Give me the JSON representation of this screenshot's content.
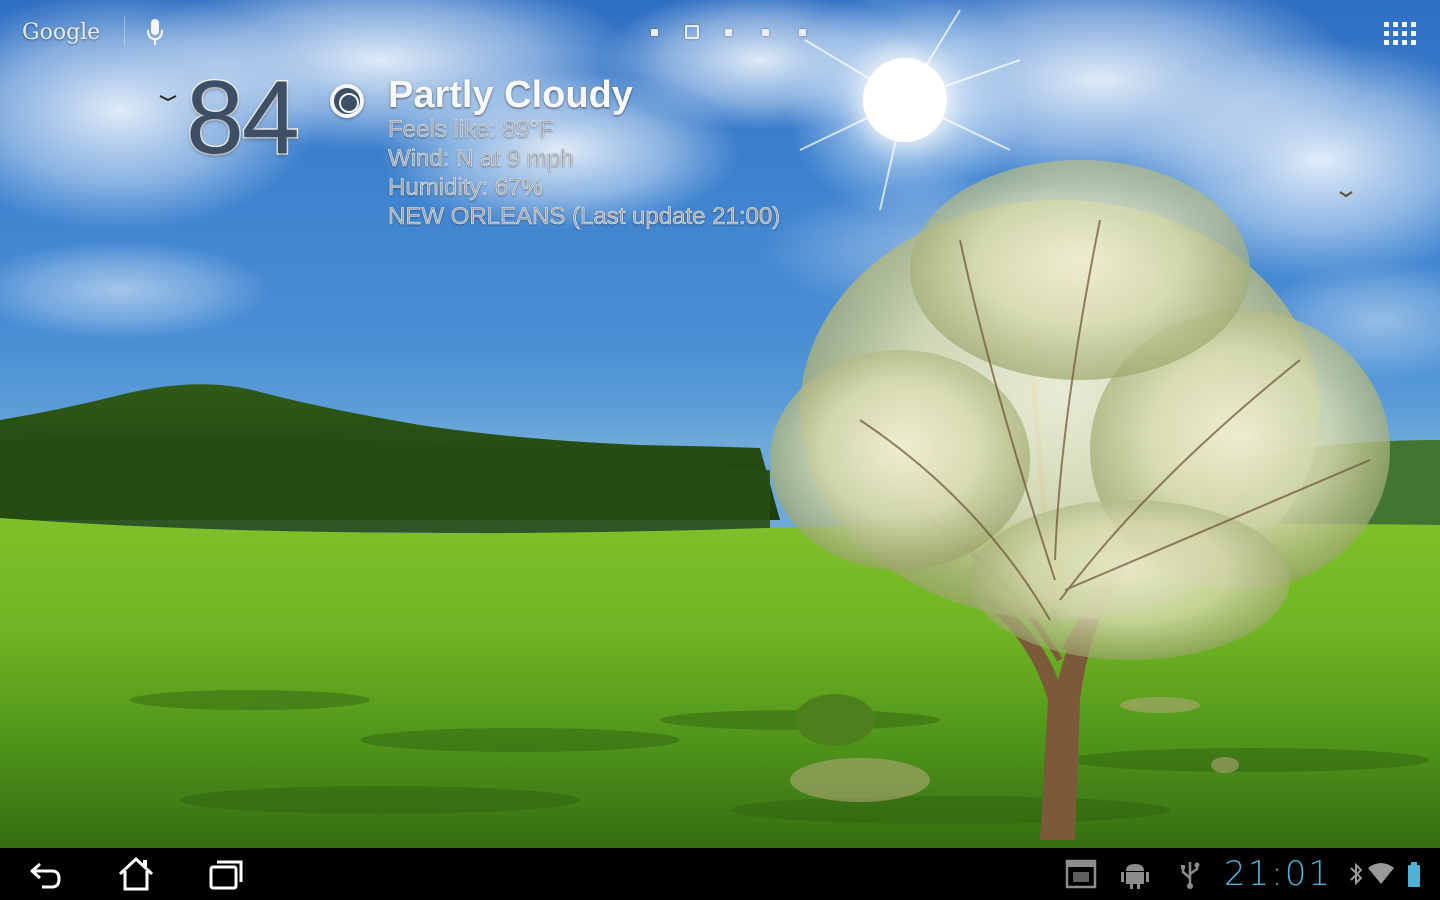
{
  "homescreen": {
    "search_label": "Google",
    "page_indicator": {
      "count": 5,
      "active_index": 1
    }
  },
  "weather": {
    "temperature": "84",
    "condition": "Partly Cloudy",
    "feels_like": "Feels like: 89°F",
    "wind": "Wind: N at 9 mph",
    "humidity": "Humidity: 67%",
    "location_update": "NEW ORLEANS (Last update 21:00)"
  },
  "system_bar": {
    "clock": "21:01",
    "accent_color": "#4fb0d8",
    "icons": [
      "back-icon",
      "home-icon",
      "recent-apps-icon",
      "screenshot-notification-icon",
      "android-debug-icon",
      "usb-icon",
      "bluetooth-icon",
      "wifi-icon",
      "battery-icon"
    ]
  }
}
